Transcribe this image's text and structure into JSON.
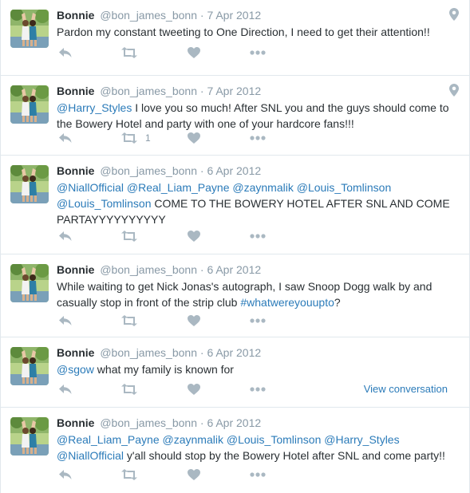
{
  "tweets": [
    {
      "name": "Bonnie",
      "handle": "@bon_james_bonn",
      "date": "7 Apr 2012",
      "has_geo": true,
      "text": [
        {
          "t": "Pardon my constant tweeting to One Direction, I need to get their attention!!",
          "k": "text"
        }
      ],
      "retweets": "",
      "view_conversation": ""
    },
    {
      "name": "Bonnie",
      "handle": "@bon_james_bonn",
      "date": "7 Apr 2012",
      "has_geo": true,
      "text": [
        {
          "t": "@Harry_Styles",
          "k": "mention"
        },
        {
          "t": " I love you so much! After SNL you and the guys should come to the Bowery Hotel and party with one of your hardcore fans!!!",
          "k": "text"
        }
      ],
      "retweets": "1",
      "view_conversation": ""
    },
    {
      "name": "Bonnie",
      "handle": "@bon_james_bonn",
      "date": "6 Apr 2012",
      "has_geo": false,
      "text": [
        {
          "t": "@NiallOfficial",
          "k": "mention"
        },
        {
          "t": " ",
          "k": "text"
        },
        {
          "t": "@Real_Liam_Payne",
          "k": "mention"
        },
        {
          "t": " ",
          "k": "text"
        },
        {
          "t": "@zaynmalik",
          "k": "mention"
        },
        {
          "t": " ",
          "k": "text"
        },
        {
          "t": "@Louis_Tomlinson",
          "k": "mention"
        },
        {
          "t": " ",
          "k": "text"
        },
        {
          "t": "@Louis_Tomlinson",
          "k": "mention"
        },
        {
          "t": " COME TO THE BOWERY HOTEL AFTER SNL AND COME PARTAYYYYYYYYYY",
          "k": "text"
        }
      ],
      "retweets": "",
      "view_conversation": ""
    },
    {
      "name": "Bonnie",
      "handle": "@bon_james_bonn",
      "date": "6 Apr 2012",
      "has_geo": false,
      "text": [
        {
          "t": "While waiting to get Nick Jonas's autograph, I saw Snoop Dogg walk by and casually stop in front of the strip club ",
          "k": "text"
        },
        {
          "t": "#whatwereyouupto",
          "k": "hashtag"
        },
        {
          "t": "?",
          "k": "text"
        }
      ],
      "retweets": "",
      "view_conversation": ""
    },
    {
      "name": "Bonnie",
      "handle": "@bon_james_bonn",
      "date": "6 Apr 2012",
      "has_geo": false,
      "text": [
        {
          "t": "@sgow",
          "k": "mention"
        },
        {
          "t": " what my family is known for",
          "k": "text"
        }
      ],
      "retweets": "",
      "view_conversation": "View conversation"
    },
    {
      "name": "Bonnie",
      "handle": "@bon_james_bonn",
      "date": "6 Apr 2012",
      "has_geo": false,
      "text": [
        {
          "t": "@Real_Liam_Payne",
          "k": "mention"
        },
        {
          "t": " ",
          "k": "text"
        },
        {
          "t": "@zaynmalik",
          "k": "mention"
        },
        {
          "t": " ",
          "k": "text"
        },
        {
          "t": "@Louis_Tomlinson",
          "k": "mention"
        },
        {
          "t": " ",
          "k": "text"
        },
        {
          "t": "@Harry_Styles",
          "k": "mention"
        },
        {
          "t": " ",
          "k": "text"
        },
        {
          "t": "@NiallOfficial",
          "k": "mention"
        },
        {
          "t": " y'all should stop by the Bowery Hotel after SNL and come party!!",
          "k": "text"
        }
      ],
      "retweets": "",
      "view_conversation": ""
    }
  ],
  "separator": "·",
  "icons": {
    "reply": "reply-icon",
    "retweet": "retweet-icon",
    "favorite": "heart-icon",
    "more": "more-icon",
    "geo": "location-pin-icon"
  },
  "colors": {
    "link": "#2b7bb9",
    "muted": "#8899a6",
    "icon": "#aab8c2",
    "text": "#292f33",
    "border": "#e1e8ed"
  }
}
